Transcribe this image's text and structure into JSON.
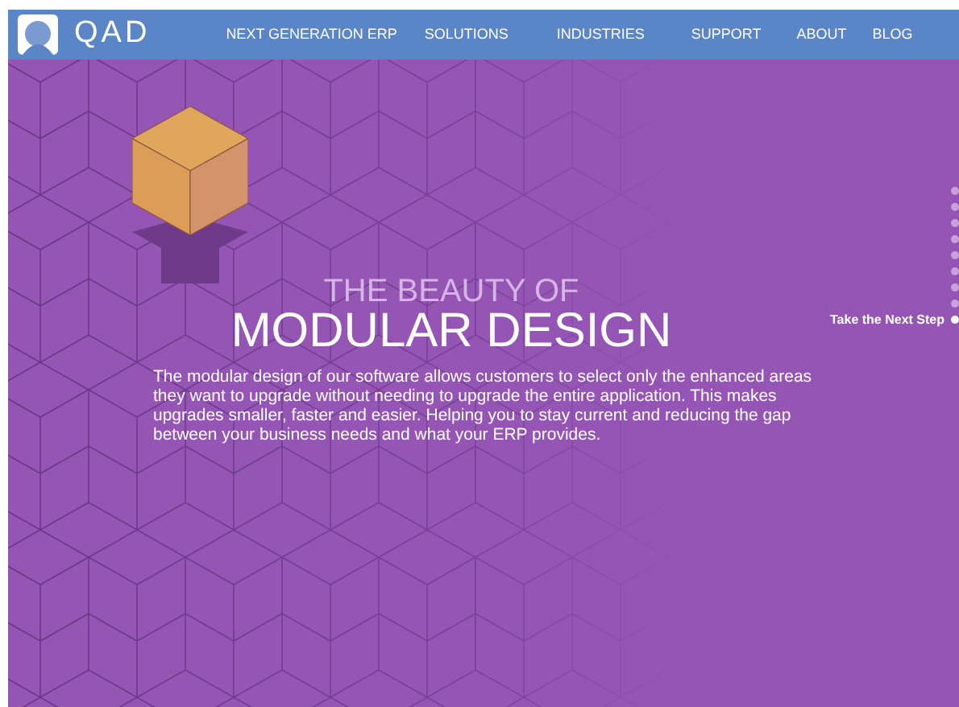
{
  "header": {
    "logo_text": "QAD",
    "nav": [
      {
        "label": "NEXT GENERATION ERP"
      },
      {
        "label": "SOLUTIONS"
      },
      {
        "label": "INDUSTRIES"
      },
      {
        "label": "SUPPORT"
      },
      {
        "label": "ABOUT"
      },
      {
        "label": "BLOG"
      }
    ]
  },
  "hero": {
    "kicker": "THE BEAUTY OF",
    "title": "MODULAR DESIGN",
    "body": "The modular design of our software allows customers to select only the enhanced areas they want to upgrade without needing to upgrade the entire application. This makes upgrades smaller, faster and easier. Helping you to stay current and reducing the gap between your business needs and what your ERP provides."
  },
  "step_nav": {
    "active_label": "Take the Next Step",
    "dots": [
      {
        "selected": false
      },
      {
        "selected": false
      },
      {
        "selected": false
      },
      {
        "selected": false
      },
      {
        "selected": false
      },
      {
        "selected": false
      },
      {
        "selected": false
      },
      {
        "selected": false
      },
      {
        "selected": true
      }
    ]
  }
}
